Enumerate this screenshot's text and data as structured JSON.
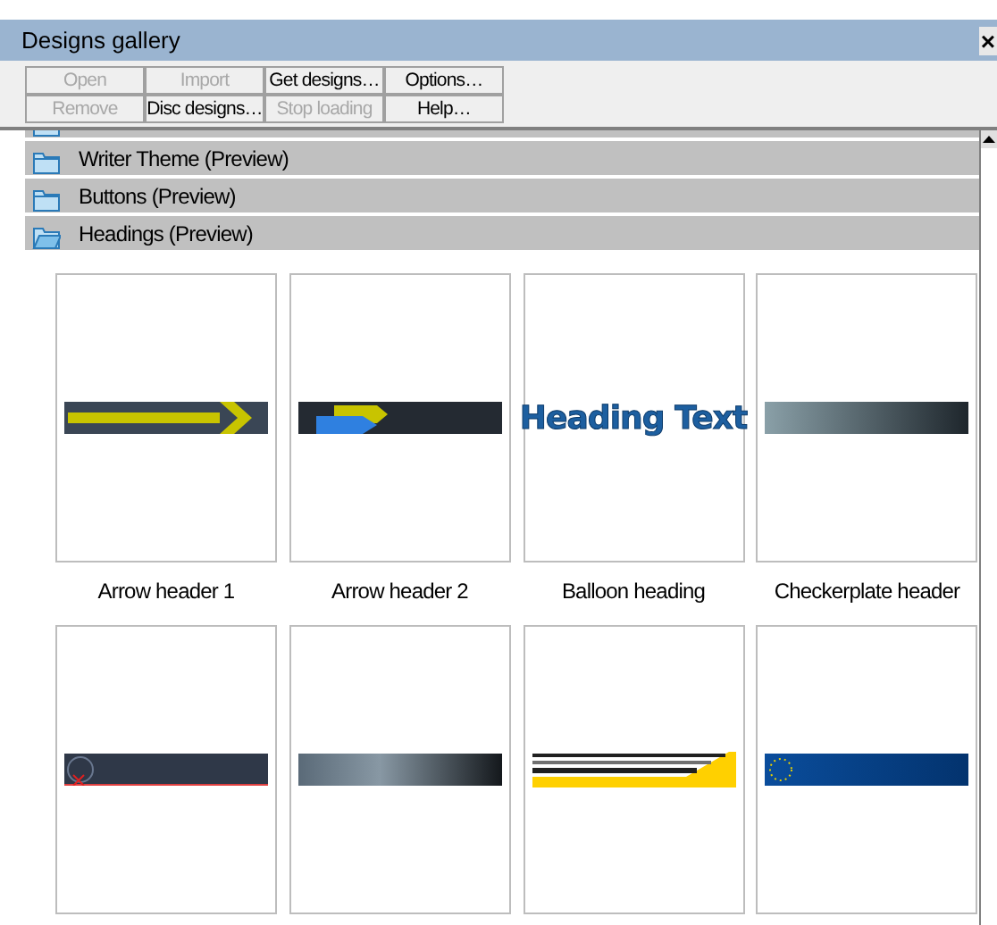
{
  "window": {
    "title": "Designs gallery",
    "close": "×"
  },
  "toolbar": [
    [
      {
        "label": "Open",
        "disabled": true
      },
      {
        "label": "Import",
        "disabled": true
      },
      {
        "label": "Get designs…",
        "disabled": false
      },
      {
        "label": "Options…",
        "disabled": false
      }
    ],
    [
      {
        "label": "Remove",
        "disabled": true
      },
      {
        "label": "Disc designs…",
        "disabled": false
      },
      {
        "label": "Stop loading",
        "disabled": true
      },
      {
        "label": "Help…",
        "disabled": false
      }
    ]
  ],
  "categories": [
    {
      "expanded": false,
      "cut": true
    },
    {
      "label": "Writer Theme (Preview)",
      "expanded": false,
      "cut": false
    },
    {
      "label": "Buttons (Preview)",
      "expanded": false,
      "cut": false
    },
    {
      "label": "Headings (Preview)",
      "expanded": true,
      "cut": false
    }
  ],
  "designs": [
    {
      "kind": "arrow-yellow",
      "caption": "Arrow header 1"
    },
    {
      "kind": "arrow-blue",
      "caption": "Arrow header 2"
    },
    {
      "kind": "balloon",
      "caption": "Balloon heading",
      "preview_text": "Heading Text"
    },
    {
      "kind": "checker",
      "caption": "Checkerplate header"
    },
    {
      "kind": "dark-red"
    },
    {
      "kind": "gray-gradient"
    },
    {
      "kind": "yellow-stripes"
    },
    {
      "kind": "blue-stars"
    }
  ]
}
